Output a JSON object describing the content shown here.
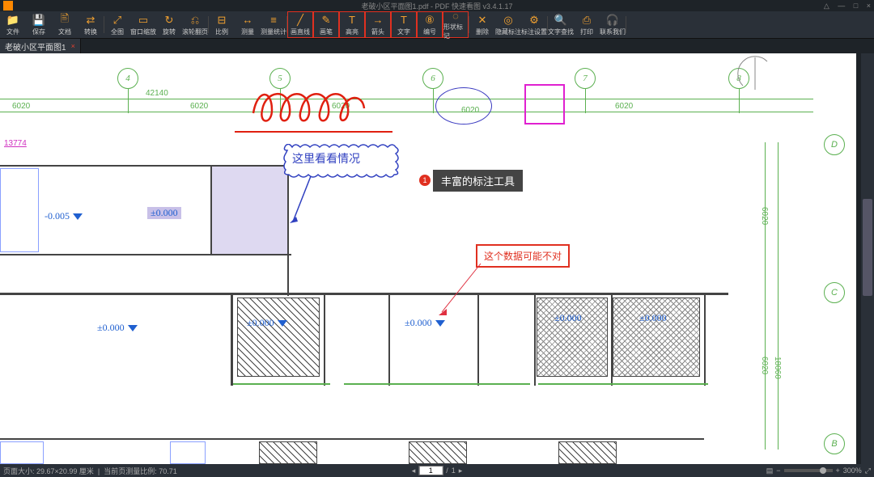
{
  "titlebar": {
    "title": "老破小区平面图1.pdf - PDF 快速看图 v3.4.1.17",
    "notif_icon": "△",
    "min": "—",
    "max": "□",
    "close": "×"
  },
  "toolbar": {
    "items": [
      {
        "label": "文件",
        "icon": "📁"
      },
      {
        "label": "保存",
        "icon": "💾"
      },
      {
        "label": "文档",
        "icon": "🖹"
      },
      {
        "label": "转换",
        "icon": "⇄"
      },
      {
        "label": "全图",
        "icon": "⤢"
      },
      {
        "label": "窗口缩放",
        "icon": "▭"
      },
      {
        "label": "旋转",
        "icon": "↻"
      },
      {
        "label": "滚轮翻页",
        "icon": "⎌"
      },
      {
        "label": "比例",
        "icon": "⊟"
      },
      {
        "label": "测量",
        "icon": "↔"
      },
      {
        "label": "测量统计",
        "icon": "≡"
      },
      {
        "label": "画直线",
        "icon": "╱"
      },
      {
        "label": "画笔",
        "icon": "✎"
      },
      {
        "label": "高亮",
        "icon": "T"
      },
      {
        "label": "箭头",
        "icon": "→"
      },
      {
        "label": "文字",
        "icon": "T"
      },
      {
        "label": "编号",
        "icon": "⑧"
      },
      {
        "label": "形状标记",
        "icon": "◌"
      },
      {
        "label": "删除",
        "icon": "✕"
      },
      {
        "label": "隐藏标注",
        "icon": "◎"
      },
      {
        "label": "标注设置",
        "icon": "⚙"
      },
      {
        "label": "文字查找",
        "icon": "🔍"
      },
      {
        "label": "打印",
        "icon": "⎙"
      },
      {
        "label": "联系我们",
        "icon": "🎧"
      }
    ]
  },
  "tabs": {
    "items": [
      {
        "name": "老破小区平面图1"
      }
    ]
  },
  "drawing": {
    "grid_cols": [
      "4",
      "5",
      "6",
      "7",
      "8"
    ],
    "grid_rows": [
      "D",
      "C",
      "B"
    ],
    "dim_top": "42140",
    "dims_6020": [
      "6020",
      "6020",
      "6020",
      "6020",
      "6020"
    ],
    "dim_side_6020": "6020",
    "dim_side_18060": "18060",
    "dim_magenta": "13774",
    "elevations": {
      "minus005": "-0.005",
      "pm_shade": "±0.000",
      "pm_a": "±0.000",
      "pm_b": "±0.000",
      "pm_c": "±0.000",
      "pm_d": "±0.000",
      "pm_e": "±0.000"
    }
  },
  "annotations": {
    "cloud_text": "这里看看情况",
    "red_box_text": "这个数据可能不对",
    "dark_label": "丰富的标注工具",
    "badge_num": "1"
  },
  "status": {
    "page_size_label": "页面大小:",
    "page_size_val": "29.67×20.99 厘米",
    "ratio_label": "当前页测量比例:",
    "ratio_val": "70.71",
    "page_cur": "1",
    "page_sep": "/",
    "page_total": "1",
    "zoom_val": "300%"
  }
}
